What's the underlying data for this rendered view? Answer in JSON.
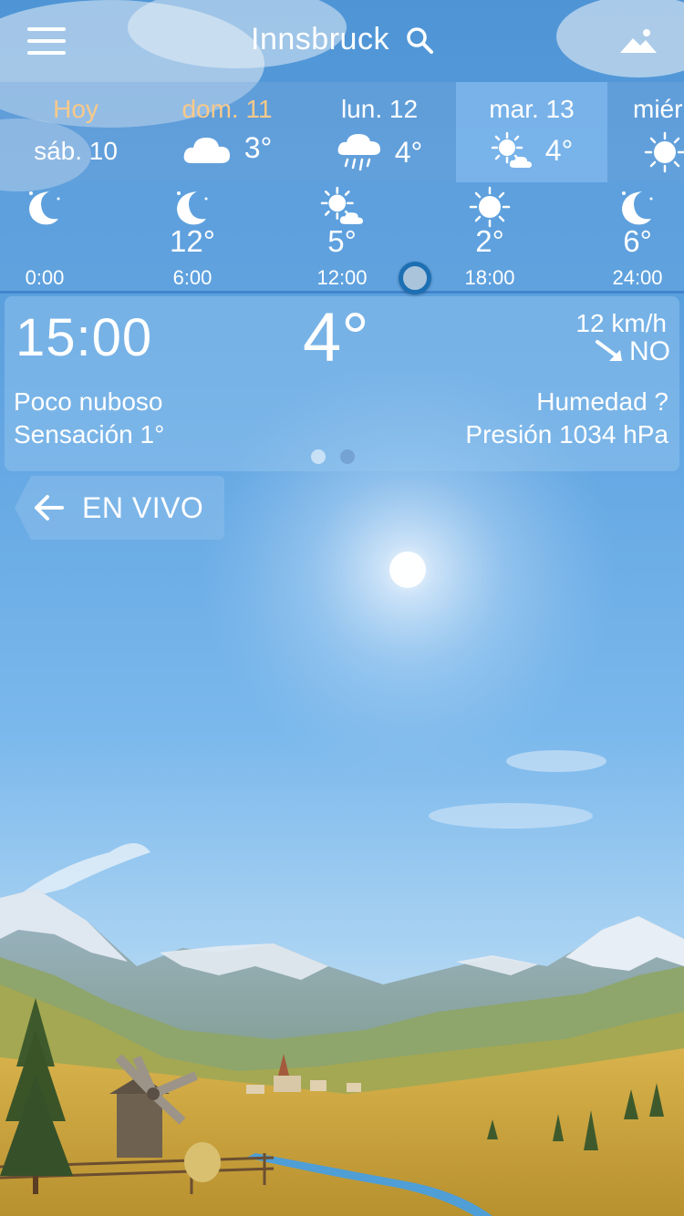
{
  "header": {
    "city": "Innsbruck"
  },
  "days": [
    {
      "name": "Hoy",
      "sub": "sáb. 10",
      "highlight": true
    },
    {
      "name": "dom. 11",
      "icon": "cloud-icon",
      "temp": "3°",
      "highlight": true
    },
    {
      "name": "lun. 12",
      "icon": "rain-cloud-icon",
      "temp": "4°"
    },
    {
      "name": "mar. 13",
      "icon": "sun-cloud-icon",
      "temp": "4°",
      "active": true
    },
    {
      "name": "miér",
      "icon": "sun-icon"
    }
  ],
  "hourly": [
    {
      "time": "0:00",
      "icon": "moon-icon",
      "temp": ""
    },
    {
      "time": "6:00",
      "icon": "moon-icon",
      "temp": "12°"
    },
    {
      "time": "12:00",
      "icon": "sun-cloud-icon",
      "temp": "5°"
    },
    {
      "time": "18:00",
      "icon": "sun-icon",
      "temp": "2°"
    },
    {
      "time": "24:00",
      "icon": "moon-icon",
      "temp": "6°"
    }
  ],
  "detail": {
    "time": "15:00",
    "temp": "4°",
    "wind_speed": "12 km/h",
    "wind_dir": "NO",
    "condition": "Poco nuboso",
    "feels_like": "Sensación 1°",
    "humidity": "Humedad ?",
    "pressure": "Presión 1034 hPa"
  },
  "live_button": {
    "label": "EN VIVO"
  },
  "colors": {
    "highlight_orange": "#f8c98a",
    "slider_ring": "#1d6fb3"
  }
}
